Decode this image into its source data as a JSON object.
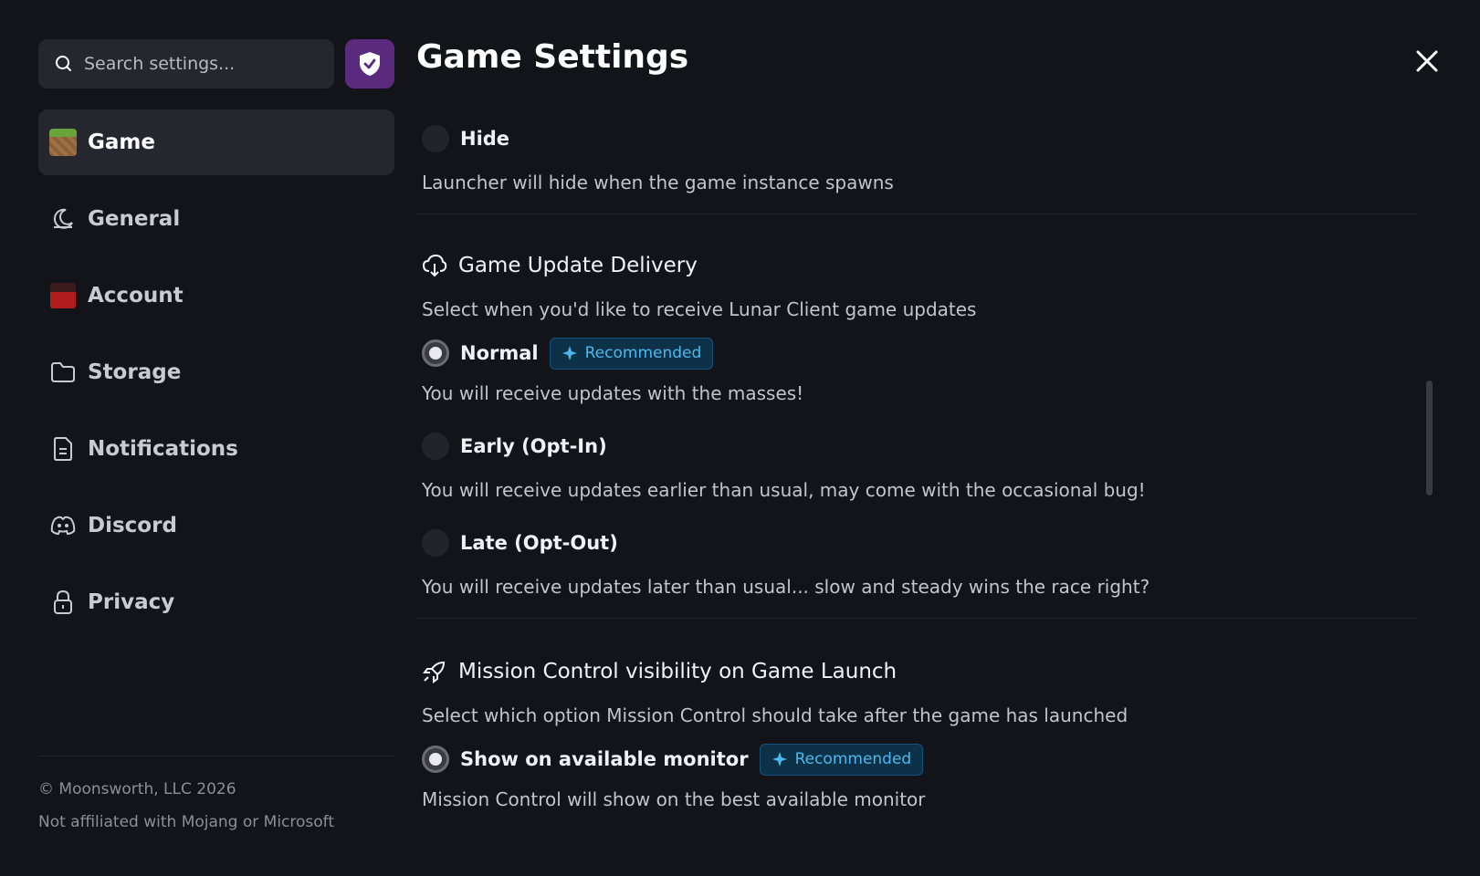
{
  "search": {
    "placeholder": "Search settings..."
  },
  "page": {
    "title": "Game Settings"
  },
  "sidebar": {
    "items": [
      {
        "label": "Game",
        "icon": "grass-block-icon",
        "active": true
      },
      {
        "label": "General",
        "icon": "moon-icon",
        "active": false
      },
      {
        "label": "Account",
        "icon": "avatar-icon",
        "active": false
      },
      {
        "label": "Storage",
        "icon": "folder-icon",
        "active": false
      },
      {
        "label": "Notifications",
        "icon": "document-icon",
        "active": false
      },
      {
        "label": "Discord",
        "icon": "discord-icon",
        "active": false
      },
      {
        "label": "Privacy",
        "icon": "lock-icon",
        "active": false
      }
    ],
    "footer": {
      "copyright": "© Moonsworth, LLC 2026",
      "disclaimer": "Not affiliated with Mojang or Microsoft"
    }
  },
  "launcher_visibility": {
    "hide": {
      "label": "Hide",
      "description": "Launcher will hide when the game instance spawns",
      "selected": false
    }
  },
  "update_delivery": {
    "title": "Game Update Delivery",
    "subtitle": "Select when you'd like to receive Lunar Client game updates",
    "options": [
      {
        "label": "Normal",
        "badge": "Recommended",
        "description": "You will receive updates with the masses!",
        "selected": true
      },
      {
        "label": "Early (Opt-In)",
        "description": "You will receive updates earlier than usual, may come with the occasional bug!",
        "selected": false
      },
      {
        "label": "Late (Opt-Out)",
        "description": "You will receive updates later than usual... slow and steady wins the race right?",
        "selected": false
      }
    ]
  },
  "mission_control": {
    "title": "Mission Control visibility on Game Launch",
    "subtitle": "Select which option Mission Control should take after the game has launched",
    "options": [
      {
        "label": "Show on available monitor",
        "badge": "Recommended",
        "description": "Mission Control will show on the best available monitor",
        "selected": true
      }
    ]
  },
  "colors": {
    "accent": "#4cb8ef",
    "shield": "#5a2a7e",
    "background": "#131419"
  }
}
